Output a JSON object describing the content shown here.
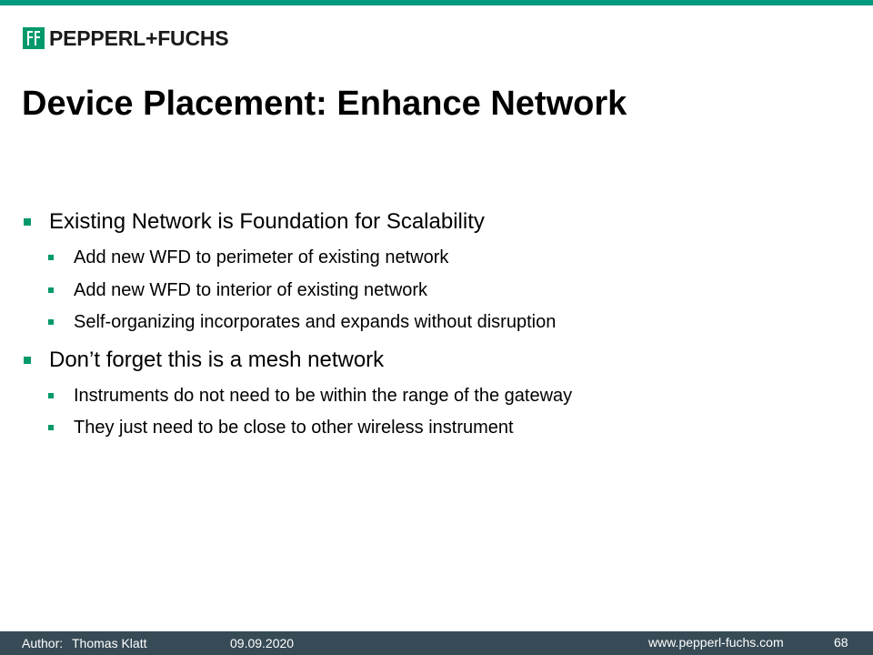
{
  "brand": {
    "logo_text": "PEPPERL+FUCHS",
    "accent_color": "#009a7e",
    "bullet_color": "#00996b",
    "footer_color": "#374b56"
  },
  "slide": {
    "title": "Device Placement: Enhance Network",
    "bullets": [
      {
        "text": "Existing Network is Foundation for Scalability",
        "sub": [
          "Add new WFD to perimeter of existing network",
          "Add new WFD to interior of existing network",
          "Self-organizing incorporates and expands without disruption"
        ]
      },
      {
        "text": "Don’t forget this is a mesh network",
        "sub": [
          "Instruments do not need to be within the range of the gateway",
          "They just need to be close to other wireless instrument"
        ]
      }
    ]
  },
  "footer": {
    "author_label": "Author:",
    "author_name": "Thomas Klatt",
    "date": "09.09.2020",
    "website": "www.pepperl-fuchs.com",
    "page_number": "68"
  }
}
